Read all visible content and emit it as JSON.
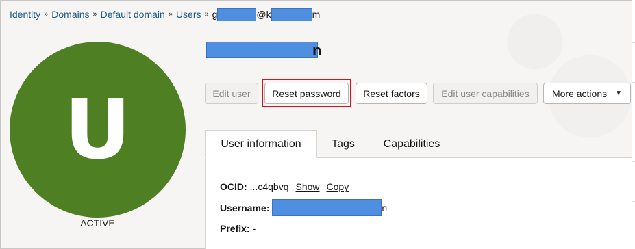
{
  "breadcrumb": {
    "items": [
      "Identity",
      "Domains",
      "Default domain",
      "Users"
    ],
    "separator": "»",
    "current_visible": [
      "g",
      "@k",
      "m"
    ]
  },
  "user": {
    "avatar_letter": "U",
    "status": "ACTIVE",
    "title_visible_tail": "n"
  },
  "toolbar": {
    "edit_user": "Edit user",
    "reset_password": "Reset password",
    "reset_factors": "Reset factors",
    "edit_capabilities": "Edit user capabilities",
    "more_actions": "More actions"
  },
  "tabs": [
    "User information",
    "Tags",
    "Capabilities"
  ],
  "info": {
    "ocid_label": "OCID:",
    "ocid_value": "...c4qbvq",
    "show_link": "Show",
    "copy_link": "Copy",
    "username_label": "Username:",
    "username_tail": "n",
    "prefix_label": "Prefix:",
    "prefix_value": "-"
  },
  "colors": {
    "avatar": "#4f7f23",
    "link": "#1b5a8a",
    "highlight": "#d8141b",
    "redaction": "#4f8fe0"
  }
}
